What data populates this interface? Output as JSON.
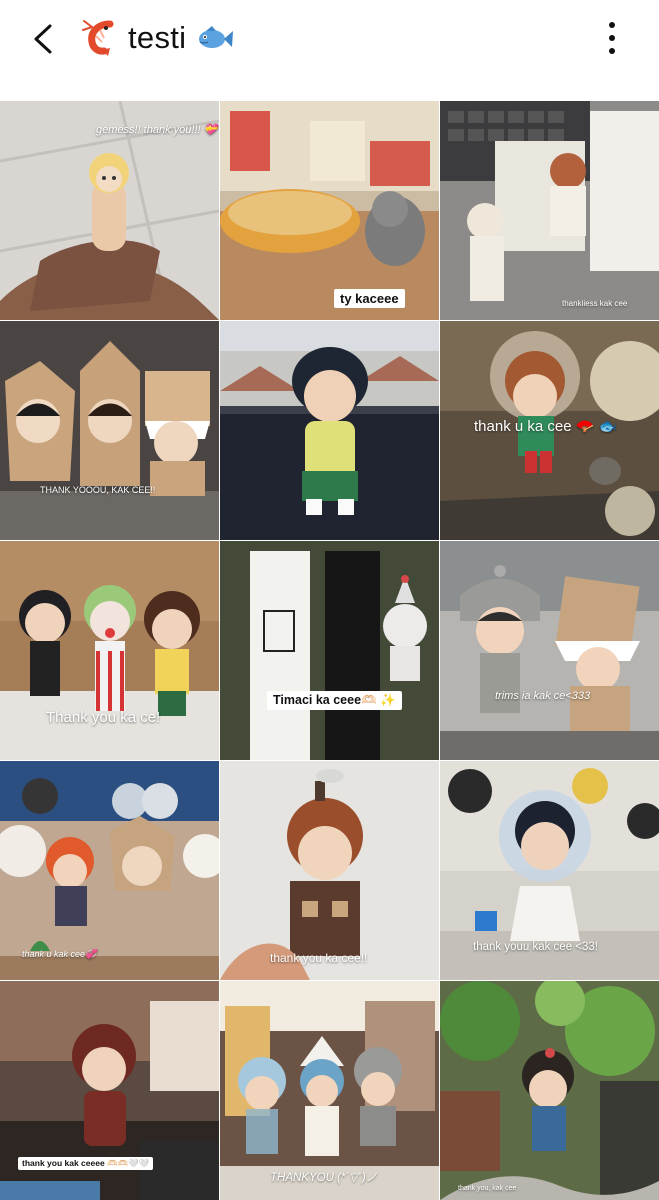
{
  "header": {
    "title": "testi",
    "back_icon": "chevron-left-icon",
    "leading_emoji_icon": "shrimp-icon",
    "trailing_emoji_icon": "fish-icon",
    "more_icon": "more-vertical-icon"
  },
  "grid": {
    "tiles": [
      {
        "caption": "gemess!! thank you!!! 💝"
      },
      {
        "caption": "ty kaceee"
      },
      {
        "caption": "thankiiess kak cee"
      },
      {
        "caption": "THANK YOOOU, KAK CEE!!"
      },
      {
        "caption": ""
      },
      {
        "caption": "thank u ka cee 🪭 🐟"
      },
      {
        "caption": "Thank you ka ce!"
      },
      {
        "caption": "Timaci ka ceee🫶🏻 ✨"
      },
      {
        "caption": "trims ia kak ce<333"
      },
      {
        "caption": "thank u kak cee💞"
      },
      {
        "caption": "thank you ka cee!!"
      },
      {
        "caption": "thank youu kak cee <33!"
      },
      {
        "caption": "thank you kak ceeee 🫶🏻🫶🏻🤍🤍"
      },
      {
        "caption": "THANKYOU (*´▽`)ノ"
      },
      {
        "caption": "thank you, kak cee"
      }
    ]
  }
}
